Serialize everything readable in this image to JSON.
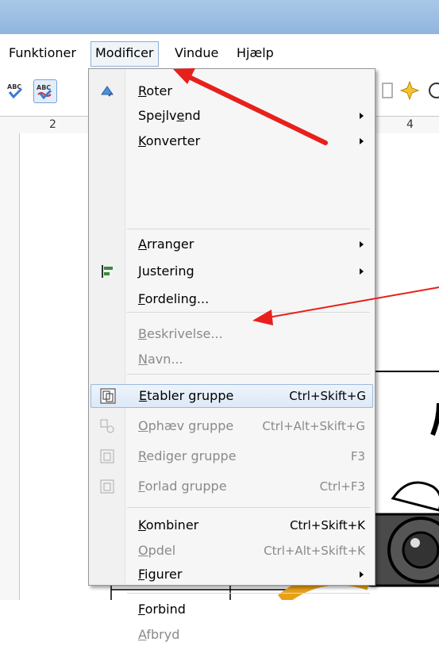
{
  "menubar": {
    "items": [
      "Funktioner",
      "Modificer",
      "Vindue",
      "Hjælp"
    ]
  },
  "ruler": {
    "h_ticks": [
      "2",
      "4"
    ]
  },
  "menu": {
    "items": [
      {
        "label": "Roter",
        "shortcut": "",
        "submenu": false,
        "enabled": true,
        "icon": "rotate-icon"
      },
      {
        "label": "Spejlvend",
        "shortcut": "",
        "submenu": true,
        "enabled": true,
        "icon": ""
      },
      {
        "label": "Konverter",
        "shortcut": "",
        "submenu": true,
        "enabled": true,
        "icon": ""
      },
      {
        "label": "Arranger",
        "shortcut": "",
        "submenu": true,
        "enabled": true,
        "icon": ""
      },
      {
        "label": "Justering",
        "shortcut": "",
        "submenu": true,
        "enabled": true,
        "icon": "align-icon"
      },
      {
        "label": "Fordeling...",
        "shortcut": "",
        "submenu": false,
        "enabled": true,
        "icon": ""
      },
      {
        "label": "Beskrivelse...",
        "shortcut": "",
        "submenu": false,
        "enabled": false,
        "icon": ""
      },
      {
        "label": "Navn...",
        "shortcut": "",
        "submenu": false,
        "enabled": false,
        "icon": ""
      },
      {
        "label": "Etabler gruppe",
        "shortcut": "Ctrl+Skift+G",
        "submenu": false,
        "enabled": true,
        "highlighted": true,
        "icon": "group-icon"
      },
      {
        "label": "Ophæv gruppe",
        "shortcut": "Ctrl+Alt+Skift+G",
        "submenu": false,
        "enabled": false,
        "icon": "ungroup-icon"
      },
      {
        "label": "Rediger gruppe",
        "shortcut": "F3",
        "submenu": false,
        "enabled": false,
        "icon": "edit-group-icon"
      },
      {
        "label": "Forlad gruppe",
        "shortcut": "Ctrl+F3",
        "submenu": false,
        "enabled": false,
        "icon": "exit-group-icon"
      },
      {
        "label": "Kombiner",
        "shortcut": "Ctrl+Skift+K",
        "submenu": false,
        "enabled": true,
        "icon": ""
      },
      {
        "label": "Opdel",
        "shortcut": "Ctrl+Alt+Skift+K",
        "submenu": false,
        "enabled": false,
        "icon": ""
      },
      {
        "label": "Figurer",
        "shortcut": "",
        "submenu": true,
        "enabled": true,
        "icon": ""
      },
      {
        "label": "Forbind",
        "shortcut": "",
        "submenu": false,
        "enabled": true,
        "icon": ""
      },
      {
        "label": "Afbryd",
        "shortcut": "",
        "submenu": false,
        "enabled": false,
        "icon": ""
      }
    ]
  },
  "colors": {
    "highlight": "#dde9f7",
    "annotation_arrow": "#e8201c",
    "titlebar": "#9ebfe3"
  }
}
